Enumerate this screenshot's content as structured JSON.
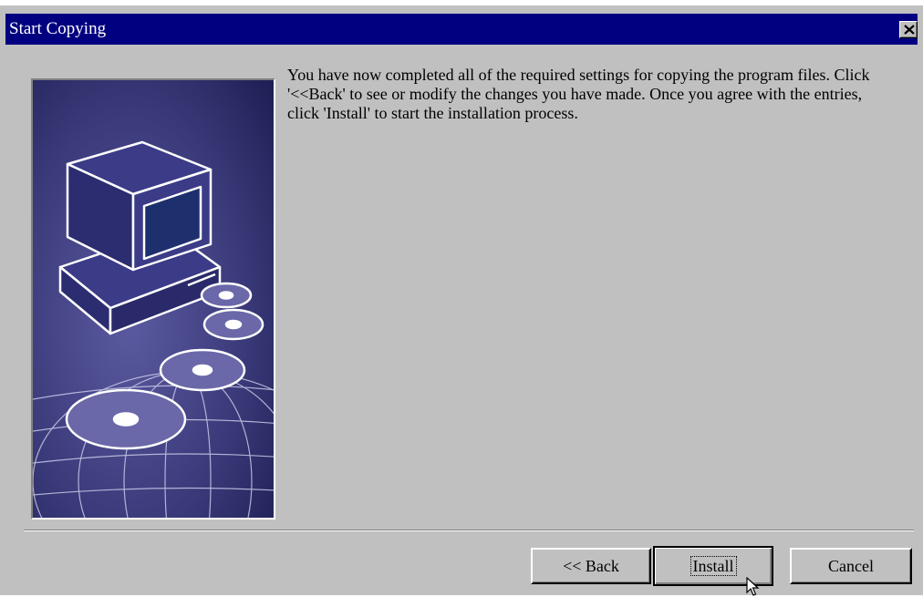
{
  "window": {
    "title": "Start Copying",
    "close_glyph": "×"
  },
  "content": {
    "instructions": "You have now completed all of the required settings for copying the program files. Click '<<Back' to see or modify the changes you have made. Once you agree with the entries, click 'Install' to start the installation process."
  },
  "buttons": {
    "back_label": "<< Back",
    "install_label": "Install",
    "cancel_label": "Cancel"
  },
  "illustration": {
    "subject": "computer-with-discs-on-globe",
    "colors": {
      "background": "#3a3a7a",
      "outline": "#ffffff",
      "monitor_body": "#3b3b88",
      "screen": "#1e2f6e",
      "disc": "#6a68a8"
    }
  },
  "colors": {
    "titlebar": "#000080",
    "window_face": "#c0c0c0",
    "title_text": "#ffffff"
  },
  "icons": [
    "close-icon",
    "computer-illustration",
    "mouse-cursor-icon"
  ]
}
